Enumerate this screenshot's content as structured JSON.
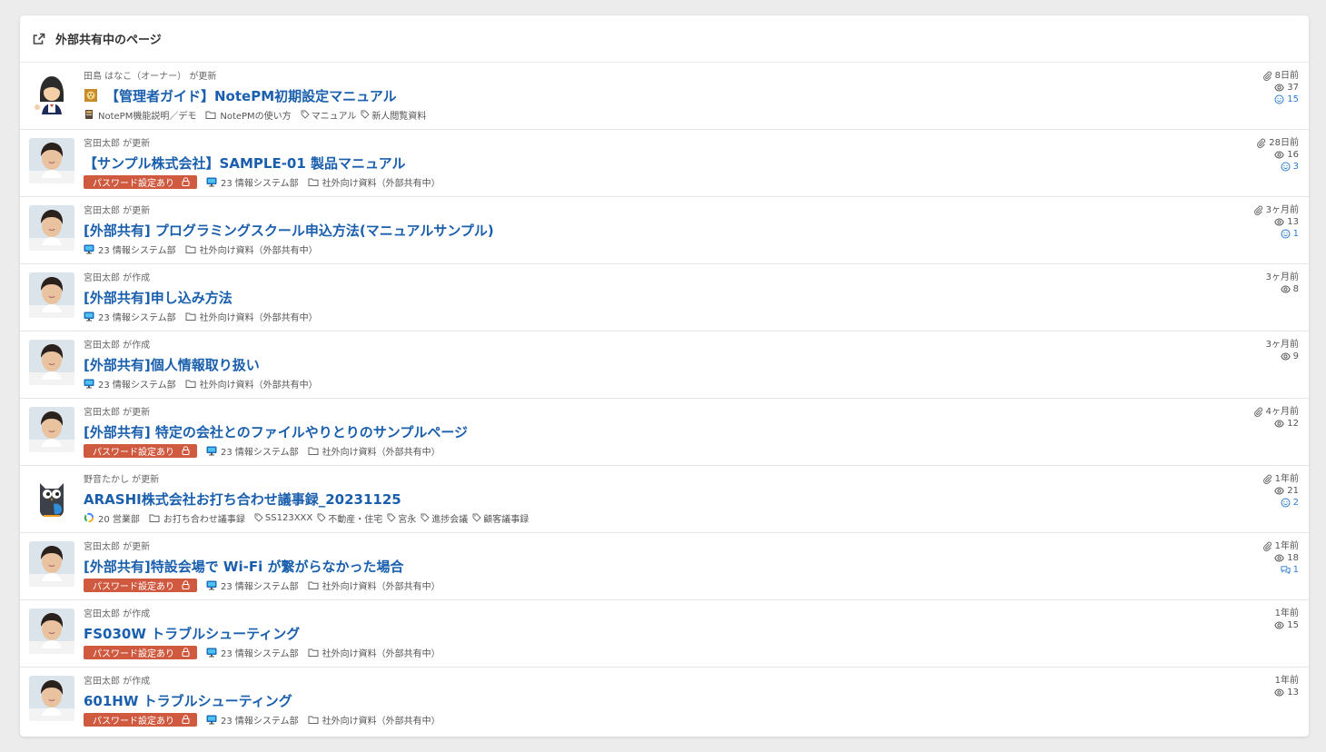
{
  "header": {
    "title": "外部共有中のページ"
  },
  "password_badge": "パスワード設定あり",
  "rows": [
    {
      "avatar": "owner-avatar",
      "meta": "田島 はなこ（オーナー） が更新",
      "title_emoji": "🦁",
      "title": "【管理者ガイド】NotePM初期設定マニュアル",
      "password": false,
      "note": "NotePM機能説明／デモ",
      "folder": "NotePMの使い方",
      "labels": [
        "マニュアル",
        "新人閲覧資料"
      ],
      "attach": true,
      "time": "8日前",
      "views": "37",
      "likes": "15",
      "comments": ""
    },
    {
      "avatar": "man-avatar",
      "meta": "宮田太郎 が更新",
      "title_emoji": "",
      "title": "【サンプル株式会社】SAMPLE-01 製品マニュアル",
      "password": true,
      "note": "23 情報システム部",
      "folder": "社外向け資料（外部共有中）",
      "labels": [],
      "attach": true,
      "time": "28日前",
      "views": "16",
      "likes": "3",
      "comments": ""
    },
    {
      "avatar": "man-avatar",
      "meta": "宮田太郎 が更新",
      "title_emoji": "",
      "title": "[外部共有] プログラミングスクール申込方法(マニュアルサンプル)",
      "password": false,
      "note": "23 情報システム部",
      "folder": "社外向け資料（外部共有中）",
      "labels": [],
      "attach": true,
      "time": "3ヶ月前",
      "views": "13",
      "likes": "1",
      "comments": ""
    },
    {
      "avatar": "man-avatar",
      "meta": "宮田太郎 が作成",
      "title_emoji": "",
      "title": "[外部共有]申し込み方法",
      "password": false,
      "note": "23 情報システム部",
      "folder": "社外向け資料（外部共有中）",
      "labels": [],
      "attach": false,
      "time": "3ヶ月前",
      "views": "8",
      "likes": "",
      "comments": ""
    },
    {
      "avatar": "man-avatar",
      "meta": "宮田太郎 が作成",
      "title_emoji": "",
      "title": "[外部共有]個人情報取り扱い",
      "password": false,
      "note": "23 情報システム部",
      "folder": "社外向け資料（外部共有中）",
      "labels": [],
      "attach": false,
      "time": "3ヶ月前",
      "views": "9",
      "likes": "",
      "comments": ""
    },
    {
      "avatar": "man-avatar",
      "meta": "宮田太郎 が更新",
      "title_emoji": "",
      "title": "[外部共有] 特定の会社とのファイルやりとりのサンプルページ",
      "password": true,
      "note": "23 情報システム部",
      "folder": "社外向け資料（外部共有中）",
      "labels": [],
      "attach": true,
      "time": "4ヶ月前",
      "views": "12",
      "likes": "",
      "comments": ""
    },
    {
      "avatar": "owl-avatar",
      "meta": "野音たかし が更新",
      "title_emoji": "",
      "title": "ARASHI株式会社お打ち合わせ議事録_20231125",
      "password": false,
      "note": "20 営業部",
      "folder": "お打ち合わせ議事録",
      "labels": [
        "SS123XXX",
        "不動産・住宅",
        "宮永",
        "進捗会議",
        "顧客議事録"
      ],
      "attach": true,
      "time": "1年前",
      "views": "21",
      "likes": "2",
      "comments": ""
    },
    {
      "avatar": "man-avatar",
      "meta": "宮田太郎 が更新",
      "title_emoji": "",
      "title": "[外部共有]特設会場で Wi-Fi が繋がらなかった場合",
      "password": true,
      "note": "23 情報システム部",
      "folder": "社外向け資料（外部共有中）",
      "labels": [],
      "attach": true,
      "time": "1年前",
      "views": "18",
      "likes": "",
      "comments": "1"
    },
    {
      "avatar": "man-avatar",
      "meta": "宮田太郎 が作成",
      "title_emoji": "",
      "title": "FS030W トラブルシューティング",
      "password": true,
      "note": "23 情報システム部",
      "folder": "社外向け資料（外部共有中）",
      "labels": [],
      "attach": false,
      "time": "1年前",
      "views": "15",
      "likes": "",
      "comments": ""
    },
    {
      "avatar": "man-avatar",
      "meta": "宮田太郎 が作成",
      "title_emoji": "",
      "title": "601HW トラブルシューティング",
      "password": true,
      "note": "23 情報システム部",
      "folder": "社外向け資料（外部共有中）",
      "labels": [],
      "attach": false,
      "time": "1年前",
      "views": "13",
      "likes": "",
      "comments": ""
    }
  ],
  "colors": {
    "link": "#1a5fad",
    "badge": "#d05a40",
    "reaction": "#2b7bd1"
  }
}
